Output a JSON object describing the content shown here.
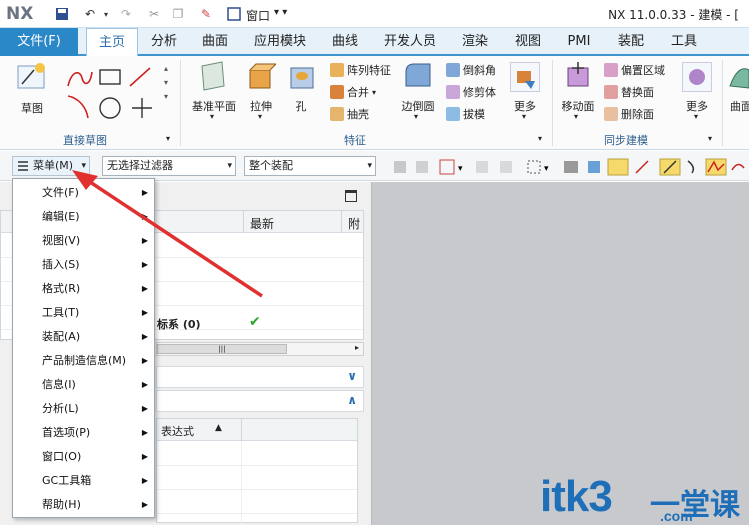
{
  "app": {
    "logo": "NX",
    "window_title": "NX 11.0.0.33 - 建模 - [",
    "window_menu": "窗口"
  },
  "menu_tabs": [
    "文件(F)",
    "主页",
    "分析",
    "曲面",
    "应用模块",
    "曲线",
    "开发人员",
    "渲染",
    "视图",
    "PMI",
    "装配",
    "工具"
  ],
  "ribbon": {
    "sketch": "草图",
    "datum_plane": "基准平面",
    "extrude": "拉伸",
    "hole": "孔",
    "pattern_feature": "阵列特征",
    "unite": "合并",
    "shell": "抽壳",
    "edge_blend": "边倒圆",
    "chamfer": "倒斜角",
    "trim_body": "修剪体",
    "draft": "拔模",
    "more1": "更多",
    "move_face": "移动面",
    "offset_region": "偏置区域",
    "replace_face": "替换面",
    "delete_face": "删除面",
    "more2": "更多",
    "surface": "曲面",
    "group_direct_sketch": "直接草图",
    "group_feature": "特征",
    "group_sync": "同步建模"
  },
  "toolbar2": {
    "menu_button": "菜单(M)",
    "filter": "无选择过滤器",
    "assembly": "整个装配"
  },
  "nav": {
    "col_latest": "最新",
    "col_attach": "附",
    "row_csys": "标系 (0)",
    "expr_header": "表达式"
  },
  "dropdown_items": [
    "文件(F)",
    "编辑(E)",
    "视图(V)",
    "插入(S)",
    "格式(R)",
    "工具(T)",
    "装配(A)",
    "产品制造信息(M)",
    "信息(I)",
    "分析(L)",
    "首选项(P)",
    "窗口(O)",
    "GC工具箱",
    "帮助(H)"
  ],
  "watermark": {
    "text": "itk3",
    "cn": "一堂课",
    "domain": ".com"
  },
  "colors": {
    "accent": "#2b88c8",
    "arrow": "#e03030"
  }
}
